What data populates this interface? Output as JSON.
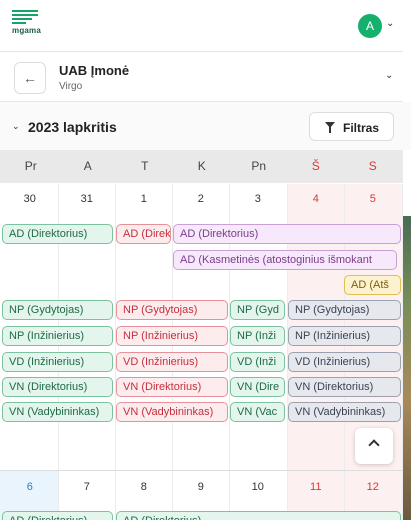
{
  "app": {
    "logo_text": "mgama",
    "avatar_letter": "A"
  },
  "company": {
    "name": "UAB Įmonė",
    "subtitle": "Virgo"
  },
  "calendar": {
    "month_title": "2023 lapkritis",
    "filter_label": "Filtras",
    "weekdays": [
      "Pr",
      "A",
      "T",
      "K",
      "Pn",
      "Š",
      "S"
    ],
    "week1_dates": [
      "30",
      "31",
      "1",
      "2",
      "3",
      "4",
      "5"
    ],
    "week2_dates": [
      "6",
      "7",
      "8",
      "9",
      "10",
      "11",
      "12"
    ],
    "events": {
      "ad_dir_1": "AD (Direktorius)",
      "ad_dir_2": "AD (Direktorius)",
      "ad_dir_3": "AD (Direktorius)",
      "ad_kasm": "AD (Kasmetinės (atostoginius išmokant",
      "ad_ats": "AD (Atš",
      "np_gyd_1": "NP (Gydytojas)",
      "np_gyd_2": "NP (Gydytojas)",
      "np_gyd_3": "NP (Gyd",
      "np_gyd_4": "NP (Gydytojas)",
      "np_inz_1": "NP (Inžinierius)",
      "np_inz_2": "NP (Inžinierius)",
      "np_inz_3": "NP (Inži",
      "np_inz_4": "NP (Inžinierius)",
      "vd_inz_1": "VD (Inžinierius)",
      "vd_inz_2": "VD (Inžinierius)",
      "vd_inz_3": "VD (Inži",
      "vd_inz_4": "VD (Inžinierius)",
      "vn_dir_1": "VN (Direktorius)",
      "vn_dir_2": "VN (Direktorius)",
      "vn_dir_3": "VN (Dire",
      "vn_dir_4": "VN (Direktorius)",
      "vn_vad_1": "VN (Vadybininkas)",
      "vn_vad_2": "VN (Vadybininkas)",
      "vn_vad_3": "VN (Vac",
      "vn_vad_4": "VN (Vadybininkas)",
      "w2_ad_1": "AD (Direktorius)",
      "w2_ad_2": "AD (Direktorius)"
    }
  },
  "colors": {
    "accent": "#16a368",
    "weekend": "#d43a3a",
    "today": "#2a7fc4"
  }
}
